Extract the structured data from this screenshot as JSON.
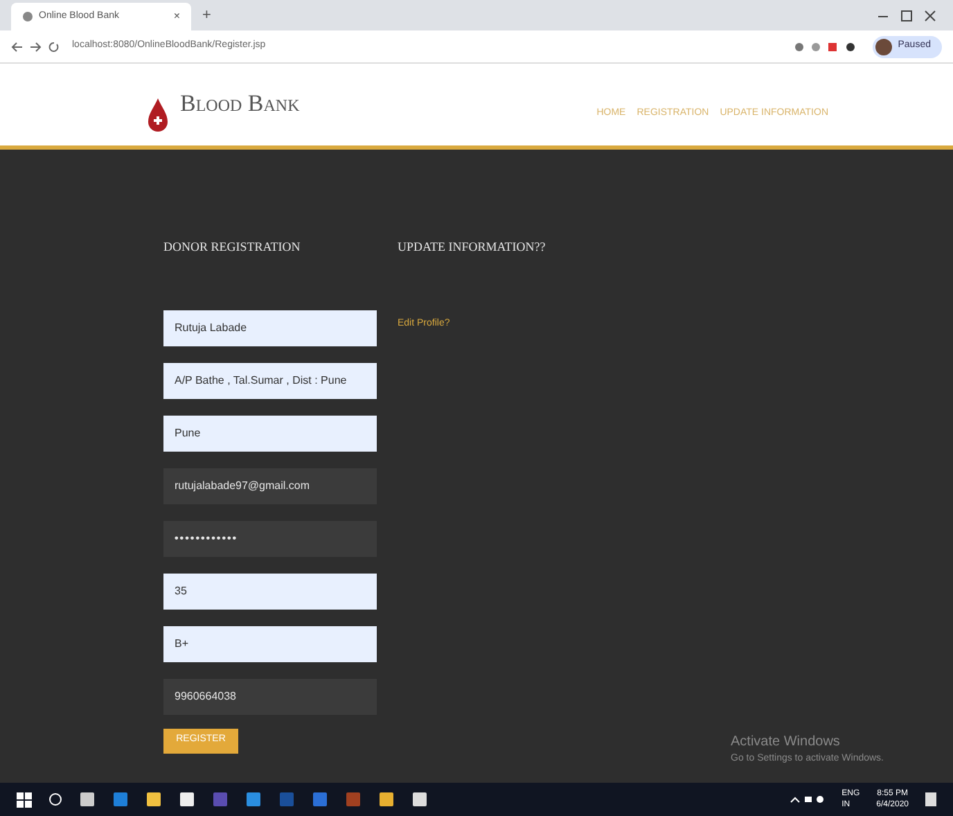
{
  "browser": {
    "tab_title": "Online Blood Bank",
    "tab_close": "×",
    "new_tab": "+",
    "url": "localhost:8080/OnlineBloodBank/Register.jsp",
    "profile": "Paused"
  },
  "header": {
    "brand": "Blood Bank",
    "nav": [
      {
        "label": "HOME"
      },
      {
        "label": "REGISTRATION"
      },
      {
        "label": "UPDATE INFORMATION"
      }
    ]
  },
  "registration": {
    "title": "DONOR REGISTRATION",
    "fields": [
      {
        "value": "Rutuja Labade",
        "autofilled": true,
        "kind": "text"
      },
      {
        "value": "A/P Bathe , Tal.Sumar , Dist : Pune",
        "autofilled": true,
        "kind": "text"
      },
      {
        "value": "Pune",
        "autofilled": true,
        "kind": "text"
      },
      {
        "value": "rutujalabade97@gmail.com",
        "autofilled": false,
        "kind": "text"
      },
      {
        "value": "••••••••••••",
        "autofilled": false,
        "kind": "password"
      },
      {
        "value": "35",
        "autofilled": true,
        "kind": "text"
      },
      {
        "value": "B+",
        "autofilled": true,
        "kind": "text"
      },
      {
        "value": "9960664038",
        "autofilled": false,
        "kind": "text"
      }
    ],
    "submit": "REGISTER"
  },
  "update": {
    "title": "UPDATE INFORMATION??",
    "link": "Edit Profile?"
  },
  "watermark_os": {
    "title": "Activate Windows",
    "subtitle": "Go to Settings to activate Windows."
  },
  "taskbar": {
    "language": "ENG",
    "region": "IN",
    "time": "8:55 PM",
    "date": "6/4/2020"
  }
}
